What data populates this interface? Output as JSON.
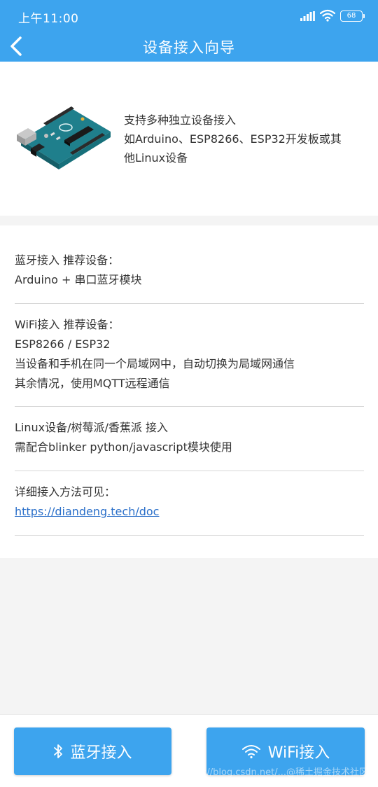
{
  "status_bar": {
    "time": "上午11:00",
    "battery": "68",
    "icons": [
      "signal-icon",
      "wifi-icon",
      "battery-icon"
    ]
  },
  "nav": {
    "title": "设备接入向导",
    "back_icon": "chevron-left-icon"
  },
  "intro": {
    "image": "arduino-board",
    "lines": [
      "支持多种独立设备接入",
      "如Arduino、ESP8266、ESP32开发板或其",
      "他Linux设备"
    ]
  },
  "sections": [
    {
      "lines": [
        "蓝牙接入 推荐设备：",
        "Arduino + 串口蓝牙模块"
      ]
    },
    {
      "lines": [
        "WiFi接入 推荐设备：",
        "ESP8266 / ESP32",
        "当设备和手机在同一个局域网中，自动切换为局域网通信",
        "其余情况，使用MQTT远程通信"
      ]
    },
    {
      "lines": [
        "Linux设备/树莓派/香蕉派 接入",
        "需配合blinker python/javascript模块使用"
      ]
    },
    {
      "lines": [
        "详细接入方法可见："
      ],
      "link": "https://diandeng.tech/doc"
    }
  ],
  "buttons": {
    "bluetooth": {
      "label": "蓝牙接入",
      "icon": "bluetooth-icon"
    },
    "wifi": {
      "label": "WiFi接入",
      "icon": "wifi-icon"
    }
  },
  "watermark": "https://blog.csdn.net/...@稀土掘金技术社区",
  "colors": {
    "primary": "#3da4ee",
    "link": "#2a6fc9",
    "background": "#f4f4f4",
    "divider": "#d6d6d6"
  }
}
